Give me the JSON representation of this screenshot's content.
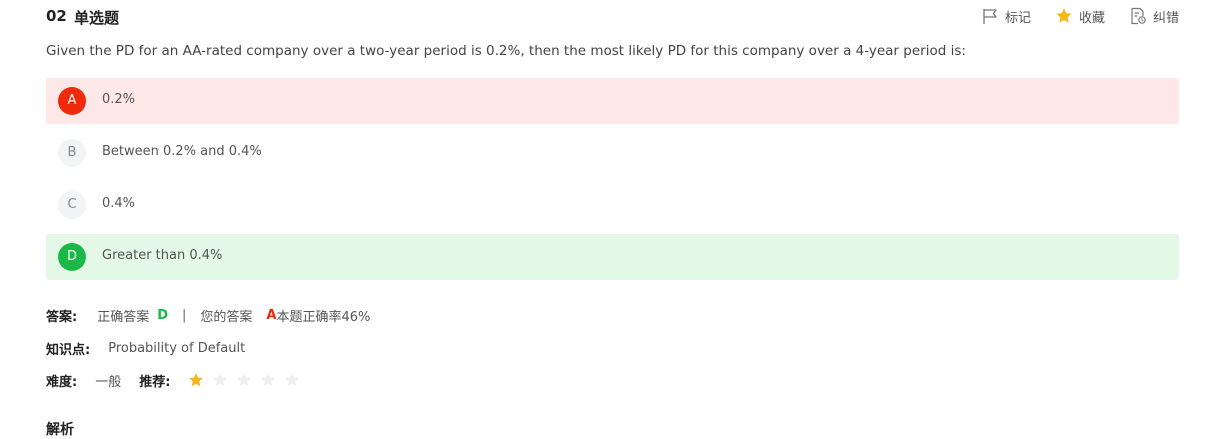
{
  "header": {
    "number": "02",
    "type": "单选题",
    "actions": {
      "mark": "标记",
      "favorite": "收藏",
      "report": "纠错"
    }
  },
  "question": "Given the PD for an AA-rated company over a two-year period is 0.2%, then the most likely PD for this company over a 4-year period is:",
  "options": [
    {
      "letter": "A",
      "text": "0.2%",
      "state": "wrong"
    },
    {
      "letter": "B",
      "text": "Between 0.2% and 0.4%",
      "state": "none"
    },
    {
      "letter": "C",
      "text": "0.4%",
      "state": "none"
    },
    {
      "letter": "D",
      "text": "Greater than 0.4%",
      "state": "correct"
    }
  ],
  "answer": {
    "label": "答案:",
    "correct_label": "正确答案",
    "correct_value": "D",
    "separator": "|",
    "yours_label": "您的答案",
    "yours_value": "A",
    "accuracy": "本题正确率46%"
  },
  "knowledge": {
    "label": "知识点:",
    "value": "Probability of Default"
  },
  "difficulty": {
    "label": "难度:",
    "value": "一般",
    "recommend_label": "推荐:",
    "rating": 1,
    "rating_max": 5
  },
  "analysis": {
    "title": "解析"
  },
  "colors": {
    "wrong_bg": "#fde7e7",
    "wrong_badge": "#f02a0c",
    "correct_bg": "#e4f8e7",
    "correct_badge": "#19b847",
    "star_on": "#f5b81c",
    "star_off": "#eeeeee"
  }
}
